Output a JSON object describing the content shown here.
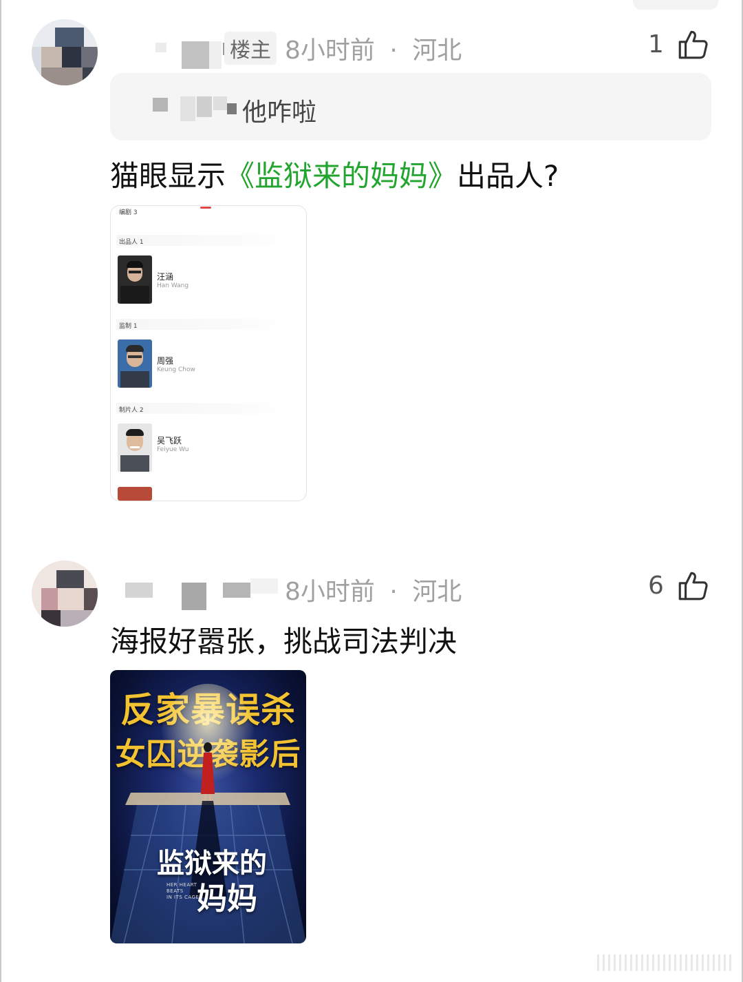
{
  "comments": [
    {
      "author_tag": "楼主",
      "time": "8小时前",
      "sep": "·",
      "location": "河北",
      "likes": "1",
      "quote": "他咋啦",
      "text_before": "猫眼显示",
      "text_link": "《监狱来的妈妈》",
      "text_after": "出品人?",
      "screenshot": {
        "sections": [
          {
            "label": "编剧 3"
          },
          {
            "label": "出品人 1",
            "person_cn": "汪涵",
            "person_en": "Han Wang"
          },
          {
            "label": "监制 1",
            "person_cn": "周强",
            "person_en": "Keung Chow"
          },
          {
            "label": "制片人 2",
            "person_cn": "吴飞跃",
            "person_en": "Feiyue Wu"
          }
        ]
      }
    },
    {
      "time": "8小时前",
      "sep": "·",
      "location": "河北",
      "likes": "6",
      "text": "海报好嚣张，挑战司法判决",
      "poster": {
        "headline_1": "反家暴误杀",
        "headline_2": "女囚逆袭影后",
        "title_1": "监狱来的",
        "title_2": "妈妈",
        "english": [
          "HER HEART",
          "BEATS",
          "IN ITS CAGE"
        ]
      }
    }
  ],
  "colors": {
    "link_green": "#22a52e",
    "meta_gray": "#a0a0a0",
    "poster_gold": "#f2c230"
  },
  "icons": [
    "thumbs-up-icon"
  ]
}
